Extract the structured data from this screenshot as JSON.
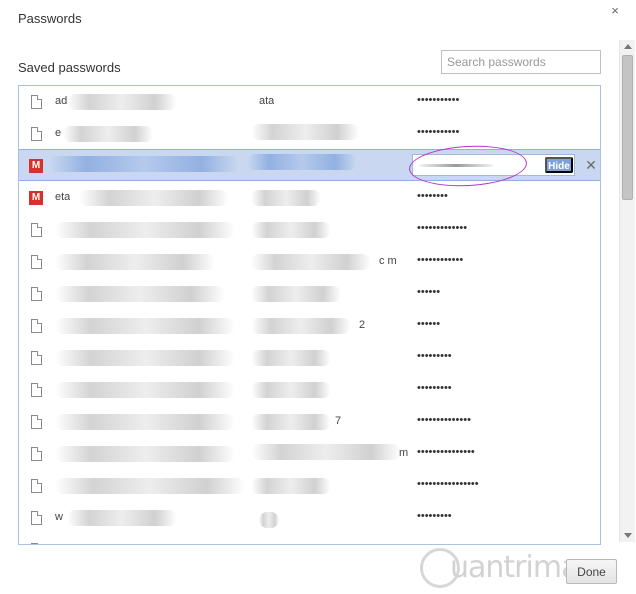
{
  "dialog": {
    "title": "Passwords",
    "close_icon": "×"
  },
  "saved": {
    "label": "Saved passwords"
  },
  "search": {
    "placeholder": "Search passwords"
  },
  "rows": [
    {
      "icon": "doc",
      "site": "ad",
      "user": "ata",
      "password": "•••••••••••"
    },
    {
      "icon": "doc",
      "site": "e",
      "user": "",
      "password": "•••••••••••"
    },
    {
      "icon": "m",
      "site": "",
      "user": "",
      "password": ""
    },
    {
      "icon": "m",
      "site": "eta",
      "user": "",
      "password": "••••••••"
    },
    {
      "icon": "doc",
      "site": "",
      "user": "",
      "password": "•••••••••••••"
    },
    {
      "icon": "doc",
      "site": "",
      "user": "c m",
      "password": "••••••••••••"
    },
    {
      "icon": "doc",
      "site": "",
      "user": "",
      "password": "••••••"
    },
    {
      "icon": "doc",
      "site": "",
      "user": "2",
      "password": "••••••"
    },
    {
      "icon": "doc",
      "site": "",
      "user": "",
      "password": "•••••••••"
    },
    {
      "icon": "doc",
      "site": "",
      "user": "",
      "password": "•••••••••"
    },
    {
      "icon": "doc",
      "site": "",
      "user": "7",
      "password": "••••••••••••••"
    },
    {
      "icon": "doc",
      "site": "",
      "user": "m",
      "password": "•••••••••••••••"
    },
    {
      "icon": "doc",
      "site": "",
      "user": "",
      "password": "••••••••••••••••"
    },
    {
      "icon": "doc",
      "site": "w",
      "user": "",
      "password": "•••••••••"
    },
    {
      "icon": "doc",
      "site": "",
      "user": "",
      "password": ""
    }
  ],
  "selected_row": {
    "hide_label": "Hide",
    "delete_icon": "✕"
  },
  "footer": {
    "done_label": "Done"
  },
  "watermark": {
    "text": "uantrimang"
  },
  "colors": {
    "selection": "#c9d8f0",
    "hide_button": "#7ea1dc",
    "m_favicon": "#d9302c",
    "annotation": "#b235c9"
  }
}
